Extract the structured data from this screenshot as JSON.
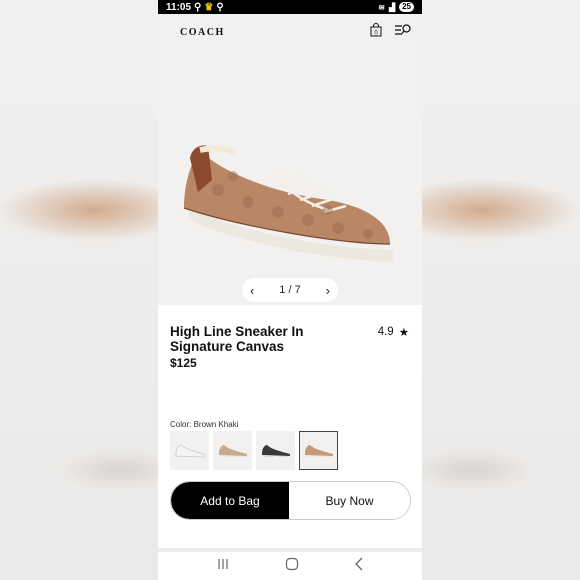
{
  "status_bar": {
    "time": "11:05",
    "battery": "25"
  },
  "header": {
    "logo": "COACH",
    "bag_count": "0"
  },
  "gallery": {
    "counter": "1 / 7"
  },
  "product": {
    "title": "High Line Sneaker In Signature Canvas",
    "rating": "4.9",
    "price": "$125",
    "color_label": "Color: Brown Khaki"
  },
  "swatches": [
    {
      "name": "white",
      "color": "#f4f4f4",
      "accent": "#dcdcdc"
    },
    {
      "name": "taupe",
      "color": "#c9ab90",
      "accent": "#ede8e2"
    },
    {
      "name": "black",
      "color": "#3a3a3a",
      "accent": "#f0f0f0"
    },
    {
      "name": "brown-khaki",
      "color": "#c69a78",
      "accent": "#f1ece4",
      "selected": true
    }
  ],
  "actions": {
    "add_to_bag": "Add to Bag",
    "buy_now": "Buy Now"
  },
  "colors": {
    "accent": "#000000",
    "background": "#f2f1ef",
    "shoe_canvas": "#b98766",
    "shoe_trim": "#8a4a2b"
  }
}
